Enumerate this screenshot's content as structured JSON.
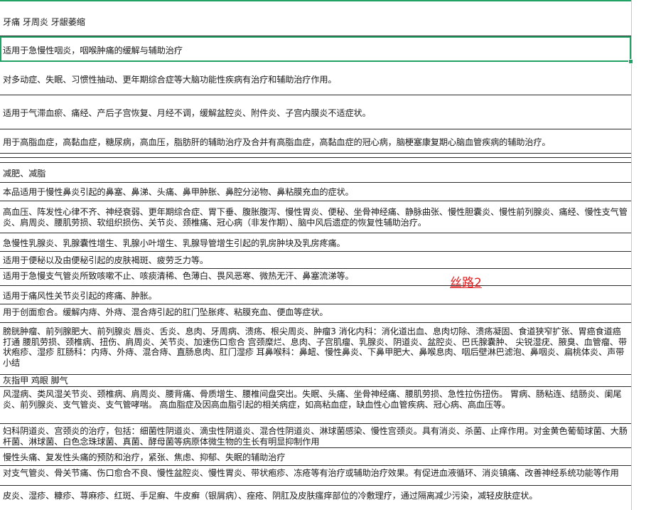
{
  "rows": [
    {
      "text": "牙痛 牙周炎 牙龈萎缩"
    },
    {
      "text": "适用于急慢性咽炎，咽喉肿痛的缓解与辅助治疗"
    },
    {
      "text": "对多动症、失眠、习惯性抽动、更年期综合症等大脑功能性疾病有治疗和辅助治疗作用。"
    },
    {
      "text": "适用于气滞血瘀、痛经、产后子宫恢复、月经不调，缓解盆腔炎、附件炎、子宫内膜炎不适症状。"
    },
    {
      "text": "用于高脂血症，高黏血症，糖尿病，高血压，脂肪肝的辅助治疗及合并有高脂血症，高黏血症的冠心病，脑梗塞康复期心脑血管疾病的辅助治疗。"
    },
    {
      "text": ""
    },
    {
      "text": ""
    },
    {
      "text": "减肥、减脂"
    },
    {
      "text": "本品适用于慢性鼻炎引起的鼻塞、鼻涕、头痛、鼻甲肿胀、鼻腔分泌物、鼻粘膜充血的症状。"
    },
    {
      "text": "高血压、阵发性心律不齐、神经衰弱、更年期综合症、胃下垂、腹胀腹泻、慢性胃炎、便秘、坐骨神经痛、静脉曲张、慢性胆囊炎、慢性前列腺炎、痛经、慢性支气管炎、肩周炎、腰肌劳损、软组织损伤、关节炎、颈椎痛、冠心病（非发作期）、脑中风后遗症的恢复性辅助治疗。"
    },
    {
      "text": "急慢性乳腺炎、乳腺囊性增生、乳腺小叶增生、乳腺导管增生引起的乳房肿块及乳房疼痛。"
    },
    {
      "text": "适用于便秘以及由便秘引起的皮肤褐斑、疲劳乏力等。"
    },
    {
      "text": "适用于急慢支气管炎所致咳嗽不止、咳痰清稀、色薄白、畏风恶寒、微热无汗、鼻塞流涕等。"
    },
    {
      "text": "适用于痛风性关节炎引起的疼痛、肿胀。"
    },
    {
      "text": "用于创面愈合。缓解内痔、外痔、混合痔引起的肛门坠胀疼、粘膜充血、便血等症状。"
    },
    {
      "text": "膀胱肿瘤、前列腺肥大、前列腺炎 唇炎、舌炎、息肉、牙周病、溃疡、根尖周炎、肿瘤3 消化内科：消化道出血、息肉切除、溃疡凝固、食道狭窄扩张、胃癌食道癌打通 腰肌劳损、颈椎病、扭伤、肩周炎、关节炎、加速伤口愈合 宫颈糜烂、息肉、子宫肌瘤、乳腺炎、阴道炎、盆腔炎、巴氏腺囊肿、 尖锐湿疣、腋臭、血管瘤、带状疱疹、湿疹 肛肠科：内痔、外痔、混合痔、直肠息肉、肛门湿疹 耳鼻喉科：鼻衄、慢性鼻炎、下鼻甲肥大、鼻喉息肉、咽后壁淋巴滤泡、鼻咽炎、扁桃体炎、声带小结"
    },
    {
      "text": "灰指甲 鸡眼 脚气"
    },
    {
      "text": "风湿病、类风湿关节炎、颈椎病、肩周炎、腰背痛、骨质增生、腰椎间盘突出。失眠、头痛、坐骨神经痛、腰肌劳损、急性拉伤扭伤。 胃病、肠粘连、结肠炎、阑尾炎、前列腺炎、支气管炎、支气管哮喘。 高血脂症及因高血脂引起的相关病症，如高粘血症，缺血性心血管疾病、冠心病、高血压等。"
    },
    {
      "text": "妇科阴道炎、宫颈炎的治疗，包括：细菌性阴道炎、滴虫性阴道炎、混合性阴道炎、淋球菌感染、慢性宫颈炎。具有消炎、杀菌、止痒作用。对金黄色葡萄球菌、大肠杆菌、淋球菌、白色念珠球菌、真菌、酵母菌等病原体微生物的生长有明显抑制作用"
    },
    {
      "text": "慢性头痛、复发性头痛的预防和治疗，紧张、焦虑、抑郁、失眠的辅助治疗"
    },
    {
      "text": "对支气管炎、骨关节痛、伤口愈合不良、慢性盆腔炎、慢性胃炎、带状疱疹、冻疮等有治疗或辅助治疗效果。有促进血液循环、消炎镇痛、改善神经系统功能等作用"
    },
    {
      "text": "皮炎、湿疹、糠疹、荨麻疹、红斑、手足癣、牛皮癣（银屑病）、痤疮、阴肛及皮肤瘙痒部位的冷敷理疗，通过隔离减少污染，减轻皮肤症状。"
    }
  ],
  "annotation": "丝路2",
  "colors": {
    "selection": "#21a366",
    "annotation": "#e02020",
    "gridline": "#2b2b2b"
  }
}
